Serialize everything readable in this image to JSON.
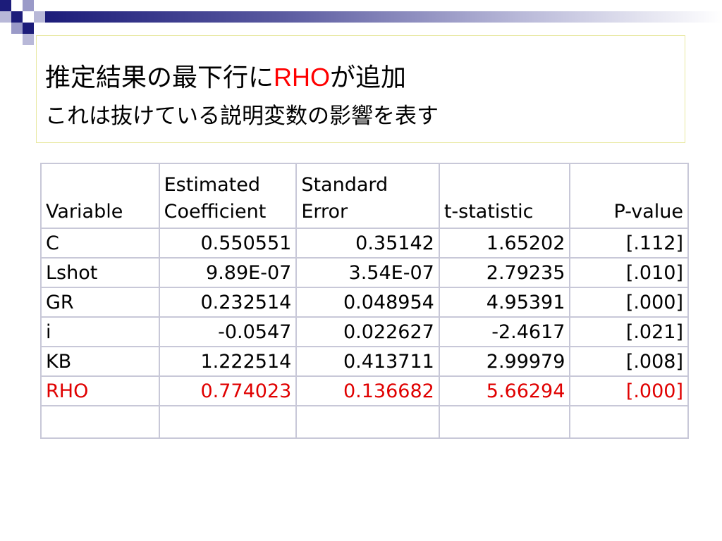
{
  "title": {
    "line1_prefix": "推定結果の最下行に",
    "line1_highlight": "RHO",
    "line1_suffix": "が追加",
    "line2": "これは抜けている説明変数の影響を表す"
  },
  "table": {
    "header_row1": [
      "",
      "Estimated",
      "Standard",
      "",
      ""
    ],
    "header_row2": [
      "Variable",
      "Coefficient",
      "Error",
      "t-statistic",
      "P-value"
    ],
    "rows": [
      {
        "variable": "C",
        "coefficient": "0.550551",
        "std_error": "0.35142",
        "t_stat": "1.65202",
        "p_value": "[.112]"
      },
      {
        "variable": "Lshot",
        "coefficient": "9.89E-07",
        "std_error": "3.54E-07",
        "t_stat": "2.79235",
        "p_value": "[.010]"
      },
      {
        "variable": "GR",
        "coefficient": "0.232514",
        "std_error": "0.048954",
        "t_stat": "4.95391",
        "p_value": "[.000]"
      },
      {
        "variable": "i",
        "coefficient": "-0.0547",
        "std_error": "0.022627",
        "t_stat": "-2.4617",
        "p_value": "[.021]"
      },
      {
        "variable": "KB",
        "coefficient": "1.222514",
        "std_error": "0.413711",
        "t_stat": "2.99979",
        "p_value": "[.008]"
      },
      {
        "variable": "RHO",
        "coefficient": "0.774023",
        "std_error": "0.136682",
        "t_stat": "5.66294",
        "p_value": "[.000]"
      }
    ]
  },
  "colors": {
    "highlight": "#e00000",
    "accent_dark": "#1c1c7a",
    "table_border": "#c8c8d8",
    "title_border": "#e8e8a0"
  }
}
